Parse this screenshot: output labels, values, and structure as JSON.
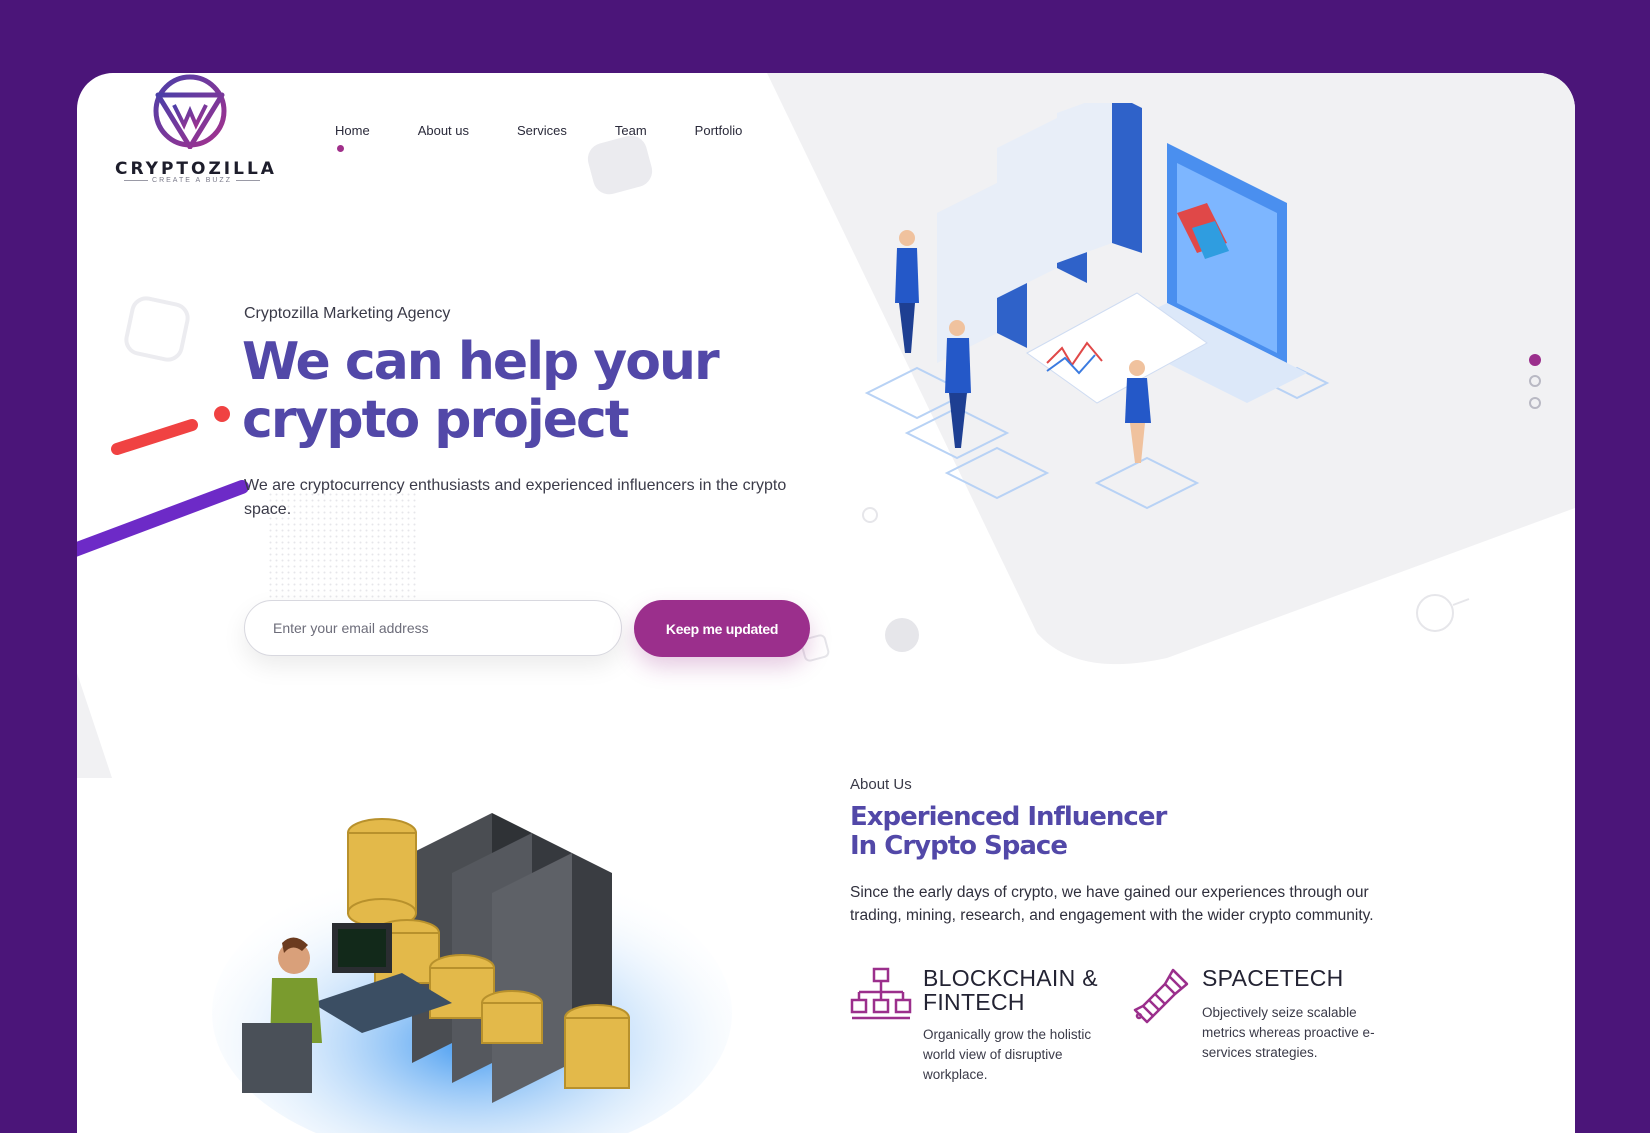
{
  "brand": {
    "name": "CRYPTOZILLA",
    "tagline": "CREATE A BUZZ",
    "primary_color": "#5248a8",
    "accent_color": "#9b2f8c",
    "background_color": "#4b1579"
  },
  "nav": {
    "items": [
      {
        "label": "Home",
        "active": true
      },
      {
        "label": "About us",
        "active": false
      },
      {
        "label": "Services",
        "active": false
      },
      {
        "label": "Team",
        "active": false
      },
      {
        "label": "Portfolio",
        "active": false
      }
    ]
  },
  "hero": {
    "eyebrow": "Cryptozilla Marketing Agency",
    "title_line1": "We can help your",
    "title_line2": "crypto project",
    "description": "We are cryptocurrency enthusiasts and experienced influencers in the crypto space.",
    "email_placeholder": "Enter your email address",
    "cta_label": "Keep me updated",
    "illustration_icon": "isometric-data-center-illustration"
  },
  "slider": {
    "dots": 3,
    "active_index": 0
  },
  "about": {
    "eyebrow": "About Us",
    "title_line1": "Experienced Influencer",
    "title_line2": "In Crypto Space",
    "description": "Since the early days of crypto, we have gained our experiences through our trading, mining, research, and engagement with the wider crypto community.",
    "illustration_icon": "crypto-mining-illustration",
    "features": [
      {
        "icon": "network-hierarchy-icon",
        "title_line1": "BLOCKCHAIN &",
        "title_line2": "FINTECH",
        "description": "Organically grow the holistic world view of disruptive workplace."
      },
      {
        "icon": "satellite-icon",
        "title_line1": "SPACETECH",
        "title_line2": "",
        "description": "Objectively seize scalable metrics whereas proactive e-services strategies."
      }
    ]
  }
}
